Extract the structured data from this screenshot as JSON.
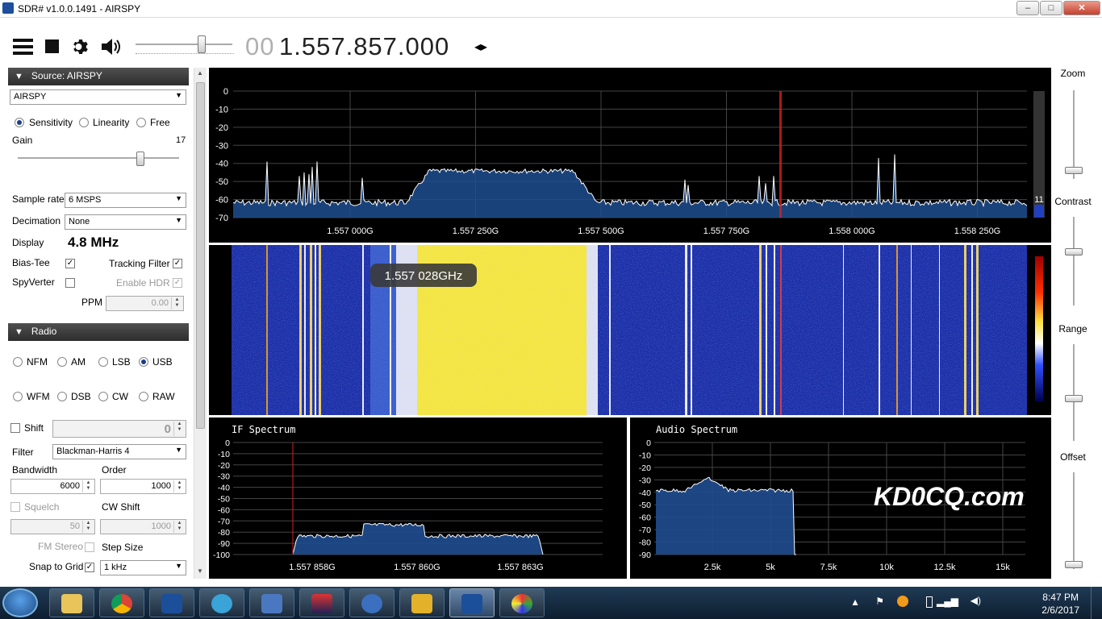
{
  "window": {
    "title": "SDR# v1.0.0.1491 - AIRSPY",
    "min": "–",
    "max": "□",
    "close": "✕"
  },
  "toolbar": {
    "icons": [
      "menu-icon",
      "stop-icon",
      "gear-icon",
      "speaker-icon"
    ],
    "freq_dim": "00",
    "freq_main": "1.557.857.000",
    "freq_arrows": "◂▸"
  },
  "source": {
    "header": "Source: AIRSPY",
    "device": "AIRSPY",
    "modes": [
      "Sensitivity",
      "Linearity",
      "Free"
    ],
    "mode_selected": "Sensitivity",
    "gain_label": "Gain",
    "gain_value": "17",
    "gain_level": 0.76,
    "sample_rate_label": "Sample rate",
    "sample_rate": "6 MSPS",
    "decimation_label": "Decimation",
    "decimation": "None",
    "display_label": "Display",
    "display_value": "4.8 MHz",
    "bias_tee_label": "Bias-Tee",
    "tracking_filter_label": "Tracking Filter",
    "spyverter_label": "SpyVerter",
    "enable_hdr_label": "Enable HDR",
    "ppm_label": "PPM",
    "ppm_value": "0.00"
  },
  "radio": {
    "header": "Radio",
    "modes_row1": [
      "NFM",
      "AM",
      "LSB",
      "USB"
    ],
    "modes_row2": [
      "WFM",
      "DSB",
      "CW",
      "RAW"
    ],
    "mode_selected": "USB",
    "shift_label": "Shift",
    "shift_value": "0",
    "filter_label": "Filter",
    "filter_value": "Blackman-Harris 4",
    "bandwidth_label": "Bandwidth",
    "bandwidth_value": "6000",
    "order_label": "Order",
    "order_value": "1000",
    "squelch_label": "Squelch",
    "squelch_value": "50",
    "cw_shift_label": "CW Shift",
    "cw_shift_value": "1000",
    "fm_stereo_label": "FM Stereo",
    "step_size_label": "Step Size",
    "snap_label": "Snap to Grid",
    "step_value": "1 kHz"
  },
  "spectrum": {
    "y_ticks": [
      "0",
      "-10",
      "-20",
      "-30",
      "-40",
      "-50",
      "-60",
      "-70"
    ],
    "x_ticks": [
      "1.557 000G",
      "1.557 250G",
      "1.557 500G",
      "1.557 750G",
      "1.558 000G",
      "1.558 250G"
    ],
    "level_readout": "11"
  },
  "waterfall": {
    "tooltip": "1.557 028GHz"
  },
  "if_spectrum": {
    "title": "IF Spectrum",
    "y_ticks": [
      "0",
      "-10",
      "-20",
      "-30",
      "-40",
      "-50",
      "-60",
      "-70",
      "-80",
      "-90",
      "-100"
    ],
    "x_ticks": [
      "1.557 858G",
      "1.557 860G",
      "1.557 863G"
    ]
  },
  "audio_spectrum": {
    "title": "Audio Spectrum",
    "y_ticks": [
      "0",
      "-10",
      "-20",
      "-30",
      "-40",
      "-50",
      "-60",
      "-70",
      "-80",
      "-90"
    ],
    "x_ticks": [
      "2.5k",
      "5k",
      "7.5k",
      "10k",
      "12.5k",
      "15k"
    ],
    "watermark": "KD0CQ.com"
  },
  "right_controls": {
    "zoom": "Zoom",
    "contrast": "Contrast",
    "range": "Range",
    "offset": "Offset"
  },
  "taskbar": {
    "apps": [
      "file-explorer",
      "chrome",
      "sdrsharp",
      "wifi-tool",
      "network-tool",
      "wr-hd",
      "thunderbird",
      "puzzle-app",
      "sdrsharp-active",
      "paint"
    ],
    "time": "8:47 PM",
    "date": "2/6/2017"
  },
  "colors": {
    "spectrum_fill": "#1f4d8f",
    "waterfall_bg": "#1b2fa8",
    "waterfall_hot": "#f5e642",
    "cursor": "#d32020"
  }
}
